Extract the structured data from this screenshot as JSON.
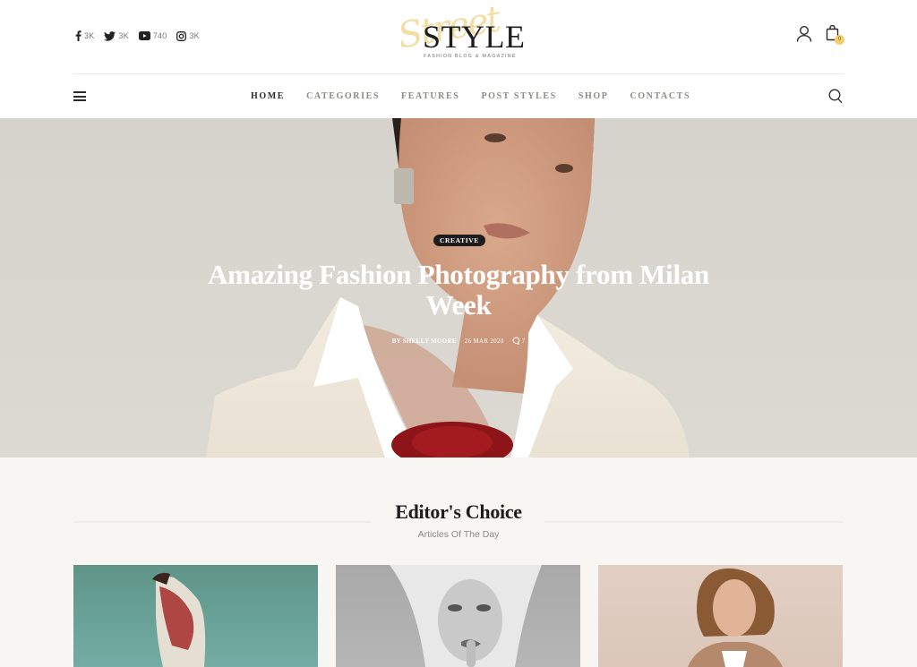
{
  "header": {
    "social": [
      {
        "icon": "facebook-icon",
        "count": "3K"
      },
      {
        "icon": "twitter-icon",
        "count": "3K"
      },
      {
        "icon": "youtube-icon",
        "count": "740"
      },
      {
        "icon": "instagram-icon",
        "count": "3K"
      }
    ],
    "logo": {
      "script": "Street",
      "main": "STYLE",
      "tagline": "FASHION BLOG & MAGAZINE"
    },
    "cart_count": "0"
  },
  "nav": {
    "items": [
      {
        "label": "HOME",
        "active": true
      },
      {
        "label": "CATEGORIES",
        "active": false
      },
      {
        "label": "FEATURES",
        "active": false
      },
      {
        "label": "POST STYLES",
        "active": false
      },
      {
        "label": "SHOP",
        "active": false
      },
      {
        "label": "CONTACTS",
        "active": false
      }
    ]
  },
  "hero": {
    "category": "CREATIVE",
    "title": "Amazing Fashion Photography from Milan Week",
    "author": "BY SHELLY MOORE",
    "date": "26 MAR 2020",
    "comments": "7"
  },
  "editors_choice": {
    "title": "Editor's Choice",
    "subtitle": "Articles Of The Day",
    "cards": [
      {
        "image": "fashion-model-teal-background"
      },
      {
        "image": "blonde-woman-black-and-white"
      },
      {
        "image": "curly-haired-man-portrait"
      }
    ]
  },
  "colors": {
    "accent": "#f6cf6b",
    "badge_bg": "#1d1d1d",
    "section_bg": "#f7f6f2",
    "nav_inactive": "#8d8a85"
  }
}
